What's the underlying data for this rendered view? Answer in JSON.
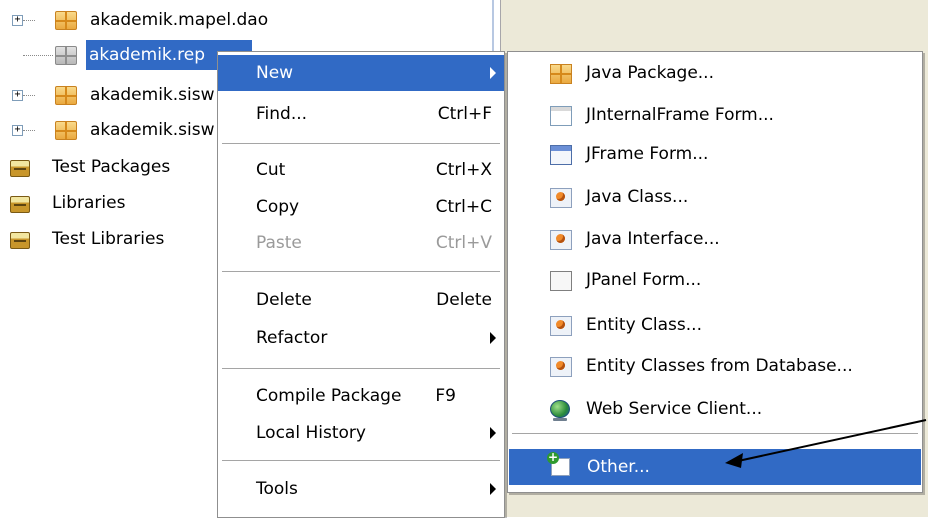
{
  "tree": {
    "items": [
      {
        "label": "akademik.mapel.dao",
        "icon": "package-icon"
      },
      {
        "label": "akademik.rep",
        "icon": "empty-package-icon",
        "selected": true
      },
      {
        "label": "akademik.sisw",
        "icon": "package-icon"
      },
      {
        "label": "akademik.sisw",
        "icon": "package-icon"
      },
      {
        "label": "Test Packages",
        "icon": "jar-icon"
      },
      {
        "label": "Libraries",
        "icon": "jar-icon"
      },
      {
        "label": "Test Libraries",
        "icon": "jar-icon"
      }
    ]
  },
  "context_menu": {
    "items": [
      {
        "label": "New",
        "has_submenu": true,
        "highlighted": true
      },
      {
        "label": "Find...",
        "shortcut": "Ctrl+F"
      },
      {
        "label": "Cut",
        "shortcut": "Ctrl+X"
      },
      {
        "label": "Copy",
        "shortcut": "Ctrl+C"
      },
      {
        "label": "Paste",
        "shortcut": "Ctrl+V",
        "disabled": true
      },
      {
        "label": "Delete",
        "shortcut": "Delete"
      },
      {
        "label": "Refactor",
        "has_submenu": true
      },
      {
        "label": "Compile Package",
        "shortcut": "F9"
      },
      {
        "label": "Local History",
        "has_submenu": true
      },
      {
        "label": "Tools",
        "has_submenu": true
      }
    ]
  },
  "new_submenu": {
    "items": [
      {
        "label": "Java Package...",
        "icon": "java-package-icon"
      },
      {
        "label": "JInternalFrame Form...",
        "icon": "jinternalframe-icon"
      },
      {
        "label": "JFrame Form...",
        "icon": "jframe-icon"
      },
      {
        "label": "Java Class...",
        "icon": "java-class-icon"
      },
      {
        "label": "Java Interface...",
        "icon": "java-interface-icon"
      },
      {
        "label": "JPanel Form...",
        "icon": "jpanel-icon"
      },
      {
        "label": "Entity Class...",
        "icon": "entity-class-icon"
      },
      {
        "label": "Entity Classes from Database...",
        "icon": "entity-classes-db-icon"
      },
      {
        "label": "Web Service Client...",
        "icon": "web-service-client-icon"
      },
      {
        "label": "Other...",
        "icon": "other-icon",
        "highlighted": true
      }
    ]
  },
  "colors": {
    "selection": "#316ac5",
    "disabled_text": "#9a9a9a",
    "menu_border": "#8f8f8f",
    "panel_background": "#ece9d8"
  }
}
